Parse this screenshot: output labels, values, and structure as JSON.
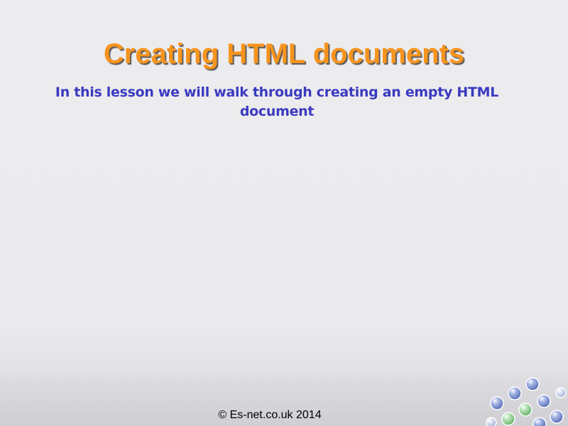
{
  "slide": {
    "title": "Creating HTML documents",
    "subtitle": "In this lesson we will walk through creating an empty HTML document",
    "footer": "© Es-net.co.uk 2014"
  },
  "colors": {
    "title": "#f7941d",
    "subtitle": "#3a3ac0",
    "bubble_blue": "#6f86c9",
    "bubble_green": "#8fcf8f"
  }
}
